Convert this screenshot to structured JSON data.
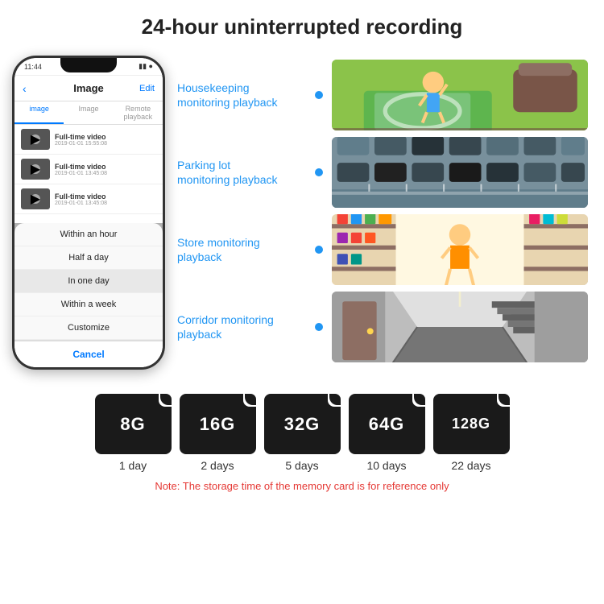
{
  "header": {
    "title": "24-hour uninterrupted recording"
  },
  "phone": {
    "status_time": "11:44",
    "status_icons": "●● ▮",
    "nav_back": "‹",
    "nav_title": "Image",
    "nav_edit": "Edit",
    "tabs": [
      "image",
      "Image",
      "Remote playback"
    ],
    "list_items": [
      {
        "title": "Full-time video",
        "date": "2019-01-01 15:55:08"
      },
      {
        "title": "Full-time video",
        "date": "2019-01-01 13:45:08"
      },
      {
        "title": "Full-time video",
        "date": "2019-01-01 13:45:08"
      }
    ],
    "dropdown_items": [
      "Within an hour",
      "Half a day",
      "In one day",
      "Within a week",
      "Customize"
    ],
    "dropdown_cancel": "Cancel"
  },
  "monitoring": [
    {
      "label": "Housekeeping\nmonitoring playback",
      "img_type": "housekeeping"
    },
    {
      "label": "Parking lot\nmonitoring playback",
      "img_type": "parking"
    },
    {
      "label": "Store monitoring\nplayback",
      "img_type": "store"
    },
    {
      "label": "Corridor monitoring\nplayback",
      "img_type": "corridor"
    }
  ],
  "sdcards": [
    {
      "capacity": "8G",
      "days": "1 day"
    },
    {
      "capacity": "16G",
      "days": "2 days"
    },
    {
      "capacity": "32G",
      "days": "5 days"
    },
    {
      "capacity": "64G",
      "days": "10 days"
    },
    {
      "capacity": "128G",
      "days": "22 days"
    }
  ],
  "note": "Note: The storage time of the memory card is for reference only"
}
